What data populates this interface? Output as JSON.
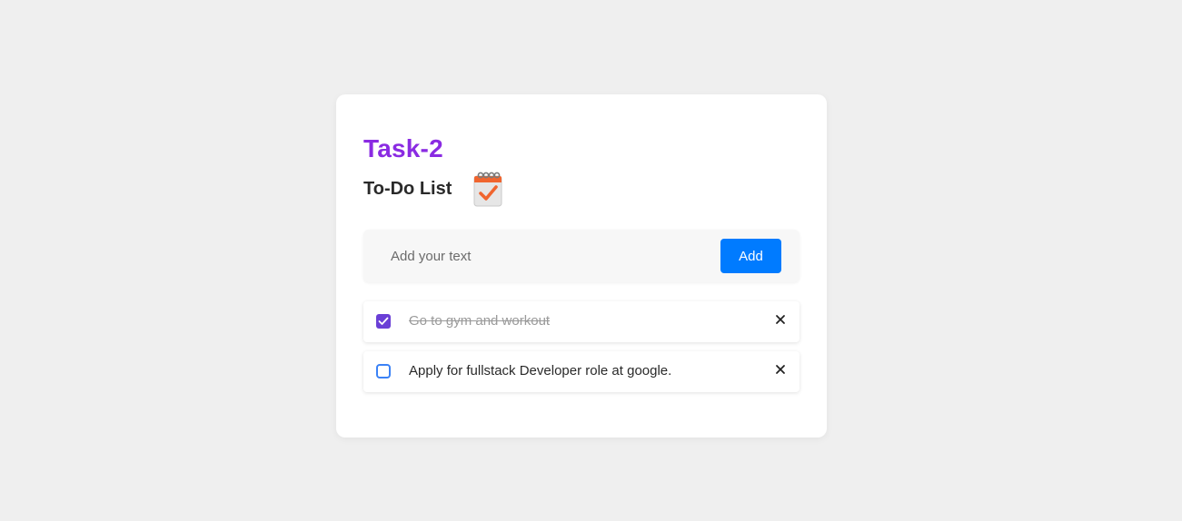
{
  "header": {
    "title": "Task-2",
    "subtitle": "To-Do List",
    "subtitle_icon": "notepad-checklist-icon"
  },
  "input": {
    "placeholder": "Add your text",
    "value": "",
    "add_label": "Add"
  },
  "colors": {
    "title": "#8a2be2",
    "add_button": "#007bff",
    "checked_box": "#6a3fd6",
    "unchecked_box_border": "#3b82f6",
    "background": "#efefef"
  },
  "tasks": [
    {
      "text": "Go to gym and workout",
      "completed": true,
      "delete_icon": "close-icon"
    },
    {
      "text": "Apply for fullstack Developer role at google.",
      "completed": false,
      "delete_icon": "close-icon"
    }
  ]
}
